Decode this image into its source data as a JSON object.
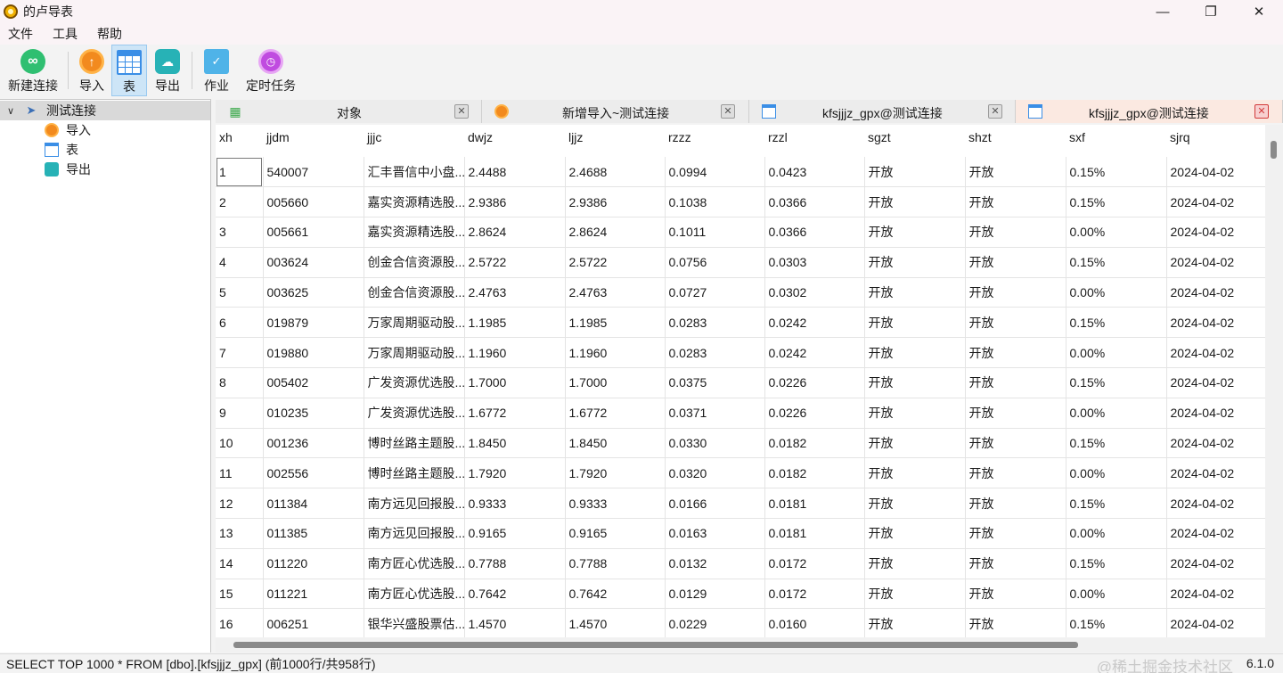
{
  "window": {
    "title": "的卢导表"
  },
  "window_controls": {
    "minimize": "—",
    "maximize": "❐",
    "close": "✕"
  },
  "menu": [
    "文件",
    "工具",
    "帮助"
  ],
  "toolbar": {
    "new_connection": "新建连接",
    "import": "导入",
    "table": "表",
    "export": "导出",
    "job": "作业",
    "scheduled_task": "定时任务"
  },
  "tree": {
    "root": "测试连接",
    "children": [
      "导入",
      "表",
      "导出"
    ]
  },
  "tabs": [
    {
      "label": "对象",
      "icon": "grid-icon"
    },
    {
      "label": "新增导入~测试连接",
      "icon": "import-icon"
    },
    {
      "label": "kfsjjjz_gpx@测试连接",
      "icon": "table-icon"
    },
    {
      "label": "kfsjjjz_gpx@测试连接",
      "icon": "table-icon",
      "active": true
    }
  ],
  "grid": {
    "columns": [
      "xh",
      "jjdm",
      "jjjc",
      "dwjz",
      "ljjz",
      "rzzz",
      "rzzl",
      "sgzt",
      "shzt",
      "sxf",
      "sjrq"
    ],
    "rows": [
      [
        "1",
        "540007",
        "汇丰晋信中小盘...",
        "2.4488",
        "2.4688",
        "0.0994",
        "0.0423",
        "开放",
        "开放",
        "0.15%",
        "2024-04-02"
      ],
      [
        "2",
        "005660",
        "嘉实资源精选股...",
        "2.9386",
        "2.9386",
        "0.1038",
        "0.0366",
        "开放",
        "开放",
        "0.15%",
        "2024-04-02"
      ],
      [
        "3",
        "005661",
        "嘉实资源精选股...",
        "2.8624",
        "2.8624",
        "0.1011",
        "0.0366",
        "开放",
        "开放",
        "0.00%",
        "2024-04-02"
      ],
      [
        "4",
        "003624",
        "创金合信资源股...",
        "2.5722",
        "2.5722",
        "0.0756",
        "0.0303",
        "开放",
        "开放",
        "0.15%",
        "2024-04-02"
      ],
      [
        "5",
        "003625",
        "创金合信资源股...",
        "2.4763",
        "2.4763",
        "0.0727",
        "0.0302",
        "开放",
        "开放",
        "0.00%",
        "2024-04-02"
      ],
      [
        "6",
        "019879",
        "万家周期驱动股...",
        "1.1985",
        "1.1985",
        "0.0283",
        "0.0242",
        "开放",
        "开放",
        "0.15%",
        "2024-04-02"
      ],
      [
        "7",
        "019880",
        "万家周期驱动股...",
        "1.1960",
        "1.1960",
        "0.0283",
        "0.0242",
        "开放",
        "开放",
        "0.00%",
        "2024-04-02"
      ],
      [
        "8",
        "005402",
        "广发资源优选股...",
        "1.7000",
        "1.7000",
        "0.0375",
        "0.0226",
        "开放",
        "开放",
        "0.15%",
        "2024-04-02"
      ],
      [
        "9",
        "010235",
        "广发资源优选股...",
        "1.6772",
        "1.6772",
        "0.0371",
        "0.0226",
        "开放",
        "开放",
        "0.00%",
        "2024-04-02"
      ],
      [
        "10",
        "001236",
        "博时丝路主题股...",
        "1.8450",
        "1.8450",
        "0.0330",
        "0.0182",
        "开放",
        "开放",
        "0.15%",
        "2024-04-02"
      ],
      [
        "11",
        "002556",
        "博时丝路主题股...",
        "1.7920",
        "1.7920",
        "0.0320",
        "0.0182",
        "开放",
        "开放",
        "0.00%",
        "2024-04-02"
      ],
      [
        "12",
        "011384",
        "南方远见回报股...",
        "0.9333",
        "0.9333",
        "0.0166",
        "0.0181",
        "开放",
        "开放",
        "0.15%",
        "2024-04-02"
      ],
      [
        "13",
        "011385",
        "南方远见回报股...",
        "0.9165",
        "0.9165",
        "0.0163",
        "0.0181",
        "开放",
        "开放",
        "0.00%",
        "2024-04-02"
      ],
      [
        "14",
        "011220",
        "南方匠心优选股...",
        "0.7788",
        "0.7788",
        "0.0132",
        "0.0172",
        "开放",
        "开放",
        "0.15%",
        "2024-04-02"
      ],
      [
        "15",
        "011221",
        "南方匠心优选股...",
        "0.7642",
        "0.7642",
        "0.0129",
        "0.0172",
        "开放",
        "开放",
        "0.00%",
        "2024-04-02"
      ],
      [
        "16",
        "006251",
        "银华兴盛股票估...",
        "1.4570",
        "1.4570",
        "0.0229",
        "0.0160",
        "开放",
        "开放",
        "0.15%",
        "2024-04-02"
      ]
    ]
  },
  "status": {
    "sql": "SELECT TOP 1000 * FROM [dbo].[kfsjjjz_gpx]  (前1000行/共958行)",
    "version": "6.1.0",
    "watermark": "@稀土掘金技术社区"
  }
}
